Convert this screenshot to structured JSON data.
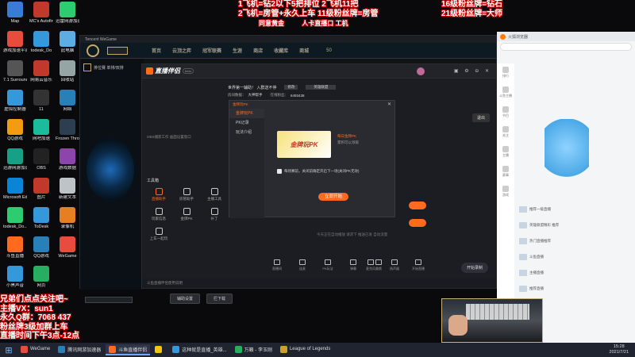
{
  "desktop_icons": [
    {
      "label": "Map",
      "color": "#3a7bd5"
    },
    {
      "label": "MC's Autofire",
      "color": "#c0392b"
    },
    {
      "label": "迅雷网游加速器",
      "color": "#2ecc71"
    },
    {
      "label": "游戏加速平台",
      "color": "#e74c3c"
    },
    {
      "label": "todesk_Do",
      "color": "#3498db"
    },
    {
      "label": "此电脑",
      "color": "#5dade2"
    },
    {
      "label": "7.1 Surround",
      "color": "#555555"
    },
    {
      "label": "网易云音乐",
      "color": "#c0392b"
    },
    {
      "label": "回收站",
      "color": "#95a5a6"
    },
    {
      "label": "虚拟控制器",
      "color": "#3498db"
    },
    {
      "label": "11",
      "color": "#333333"
    },
    {
      "label": "网络",
      "color": "#2980b9"
    },
    {
      "label": "QQ游戏",
      "color": "#f39c12"
    },
    {
      "label": "网吧加速",
      "color": "#1abc9c"
    },
    {
      "label": "Frozen Throne",
      "color": "#2c3e50"
    },
    {
      "label": "迅游网游加速 0.6.24",
      "color": "#16a085"
    },
    {
      "label": "OBS",
      "color": "#222222"
    },
    {
      "label": "游戏数据",
      "color": "#8e44ad"
    },
    {
      "label": "Microsoft Edge",
      "color": "#0a84d6"
    },
    {
      "label": "图片",
      "color": "#c0392b"
    },
    {
      "label": "新建文本",
      "color": "#bdc3c7"
    },
    {
      "label": "todesk_Do...",
      "color": "#2ecc71"
    },
    {
      "label": "ToDesk",
      "color": "#3498db"
    },
    {
      "label": "录像机",
      "color": "#e67e22"
    },
    {
      "label": "斗鱼直播",
      "color": "#ff6a1f"
    },
    {
      "label": "QQ游戏",
      "color": "#2980b9"
    },
    {
      "label": "WeGame",
      "color": "#e74c3c"
    },
    {
      "label": "小黑声音",
      "color": "#3498db"
    },
    {
      "label": "网页",
      "color": "#27ae60"
    }
  ],
  "overlay": {
    "top_left": [
      "1飞机=钻2以下5把排位  2飞机11把",
      "2飞机=房管+永久上车  11级粉丝牌=房管"
    ],
    "top_mid": [
      "同意黄金",
      "人卡直播口 工机"
    ],
    "top_right": [
      "16级粉丝牌=钻石",
      "21级粉丝牌=大师"
    ],
    "bottom_left": [
      "兄弟们点点关注吧~",
      "主播VX：sun1",
      "永久Q群：7068 437",
      "粉丝牌3级加群上车",
      "直播时间下午3点-12点"
    ]
  },
  "lol_client": {
    "title": "Tencent WeGame",
    "left_tab": "排位赛 单排/双排",
    "nav": [
      "首页",
      "云顶之弈",
      "冠军联赛",
      "生涯",
      "商店",
      "收藏库",
      "商城"
    ],
    "currency": "50",
    "login_btn": "登录",
    "bottom_buttons": [
      "辅助设置",
      "拦下载"
    ]
  },
  "douyu": {
    "logo": "直播伴侣",
    "version": "beta",
    "title_input": "世界第一辅助！ 入群送不停",
    "modify_btn": "修改",
    "category": "英雄联盟",
    "room_label": "房间数据：",
    "room_value": "大神帮手",
    "fans_label": "在线粉丝：",
    "fans_value": "6493438",
    "hint": "OBS捕获工作 画面设置窗口",
    "tool_title": "工具箱",
    "tools": [
      "直播助手",
      "房管助手",
      "主播工具"
    ],
    "tools2": [
      "玩家信息",
      "金牌PK",
      "补丁"
    ],
    "tools3": [
      "上车一起玩"
    ],
    "exit_btn": "退出",
    "preview_text": "已开始 画面",
    "bottom_icons": [
      "直播间",
      "连麦",
      "PK玩法",
      "弹幕",
      "美颜"
    ],
    "bottom_right": [
      "麦克风",
      "扬声器",
      "开始直播"
    ],
    "footer_text": "斗鱼直播伴侣使用说明",
    "side_list": [
      "金牌玩法",
      "PK记录",
      "玩法介绍"
    ],
    "start_btn": "开始录制",
    "notice": "今天正在自动播放 请求下 推送已发 自动流量"
  },
  "dialog": {
    "header": "金牌玩PK",
    "sidebar": [
      "金牌玩PK",
      "PK记录",
      "玩法介绍"
    ],
    "banner_text": "金牌玩PK",
    "banner_title": "每日金牌PK",
    "banner_sub": "累积可以领取",
    "checkbox_label": "每场赛前，关闭前确定开启下一场(关闭PK无效)",
    "confirm_btn": "立即开始",
    "status": "上"
  },
  "browser": {
    "title": "火狐浏览器",
    "sidebar_items": [
      "排行",
      "斗鱼主播",
      "节目",
      "关注",
      "主播",
      "赛事",
      "游戏"
    ],
    "links": [
      "推荐一级直播",
      "英雄联盟精彩 推荐",
      "热门直播推荐",
      "斗鱼直播",
      "主播直播",
      "推荐直播"
    ]
  },
  "taskbar": {
    "start": "⊞",
    "items": [
      {
        "label": "WeGame",
        "color": "#e74c3c",
        "active": false
      },
      {
        "label": "腾讯网游加速器",
        "color": "#2980b9",
        "active": false
      },
      {
        "label": "斗鱼直播伴侣",
        "color": "#ff6a1f",
        "active": true
      },
      {
        "label": "",
        "color": "#f1c40f",
        "active": false
      },
      {
        "label": "这种就是直播_英雄...",
        "color": "#3498db",
        "active": false
      },
      {
        "label": "万籁 - 李玉刚",
        "color": "#27ae60",
        "active": false
      },
      {
        "label": "League of Legends",
        "color": "#c9a227",
        "active": false
      }
    ],
    "time": "15:28",
    "date": "2021/7/21"
  }
}
